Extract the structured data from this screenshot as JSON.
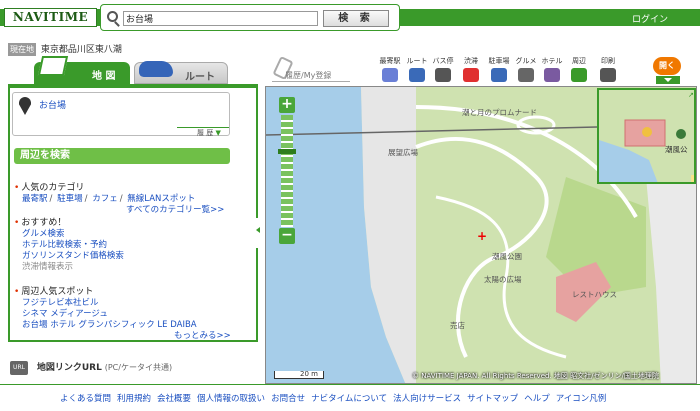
{
  "header": {
    "logo": "NAVITIME",
    "search_value": "お台場",
    "search_button": "検 索",
    "login": "ログイン"
  },
  "location": {
    "badge": "現在地",
    "name": "東京都品川区東八潮"
  },
  "tabs": {
    "map": "地 図",
    "route": "ルート",
    "history": "履歴/My登録"
  },
  "tools": [
    {
      "label": "最寄駅",
      "icon": "station-icon",
      "color": "#6a7fd6"
    },
    {
      "label": "ルート",
      "icon": "car-icon",
      "color": "#3a6ab8"
    },
    {
      "label": "バス停",
      "icon": "bus-stop-icon",
      "color": "#555555"
    },
    {
      "label": "渋滞",
      "icon": "traffic-icon",
      "color": "#e03030"
    },
    {
      "label": "駐車場",
      "icon": "parking-icon",
      "color": "#3a6ab8"
    },
    {
      "label": "グルメ",
      "icon": "gourmet-icon",
      "color": "#666666"
    },
    {
      "label": "ホテル",
      "icon": "hotel-icon",
      "color": "#7a5aa0"
    },
    {
      "label": "周辺",
      "icon": "nearby-icon",
      "color": "#3a9a2a"
    },
    {
      "label": "印刷",
      "icon": "print-icon",
      "color": "#555555"
    }
  ],
  "open_button": "開く",
  "panel": {
    "poi_name": "お台場",
    "history_button": "履 歴",
    "nearby_header": "周辺を検索",
    "popular_title": "人気のカテゴリ",
    "popular_links": [
      "最寄駅",
      "駐車場",
      "カフェ",
      "無線LANスポット"
    ],
    "all_categories": "すべてのカテゴリー覧>>",
    "recommended_title": "おすすめ！",
    "recommended": [
      "グルメ検索",
      "ホテル比較検索・予約",
      "ガソリンスタンド価格検索",
      "渋滞情報表示"
    ],
    "spots_title": "周辺人気スポット",
    "spots": [
      "フジテレビ本社ビル",
      "シネマ メディアージュ",
      "お台場 ホテル グランパシフィック LE DAIBA"
    ],
    "more": "もっとみる>>",
    "link_url_icon": "URL",
    "link_url": "地図リンクURL",
    "link_url_sub": "(PC/ケータイ共通)"
  },
  "map": {
    "labels": [
      "潮と月のプロムナード",
      "展望広場",
      "潮風公園",
      "太陽の広場",
      "レストハウス",
      "売店",
      "潮風公"
    ],
    "scale": "20 m",
    "copyright": "© NAVITIME JAPAN. All Rights Reserved. 地図 昭文社/ゼンリン/国土地理院",
    "zoom_level_fraction": 0.7
  },
  "footer": [
    "よくある質問",
    "利用規約",
    "会社概要",
    "個人情報の取扱い",
    "お問合せ",
    "ナビタイムについて",
    "法人向けサービス",
    "サイトマップ",
    "ヘルプ",
    "アイコン凡例"
  ],
  "colors": {
    "brand_green": "#3a9a2a",
    "link_blue": "#1a4fc0",
    "accent_orange": "#f07800"
  }
}
